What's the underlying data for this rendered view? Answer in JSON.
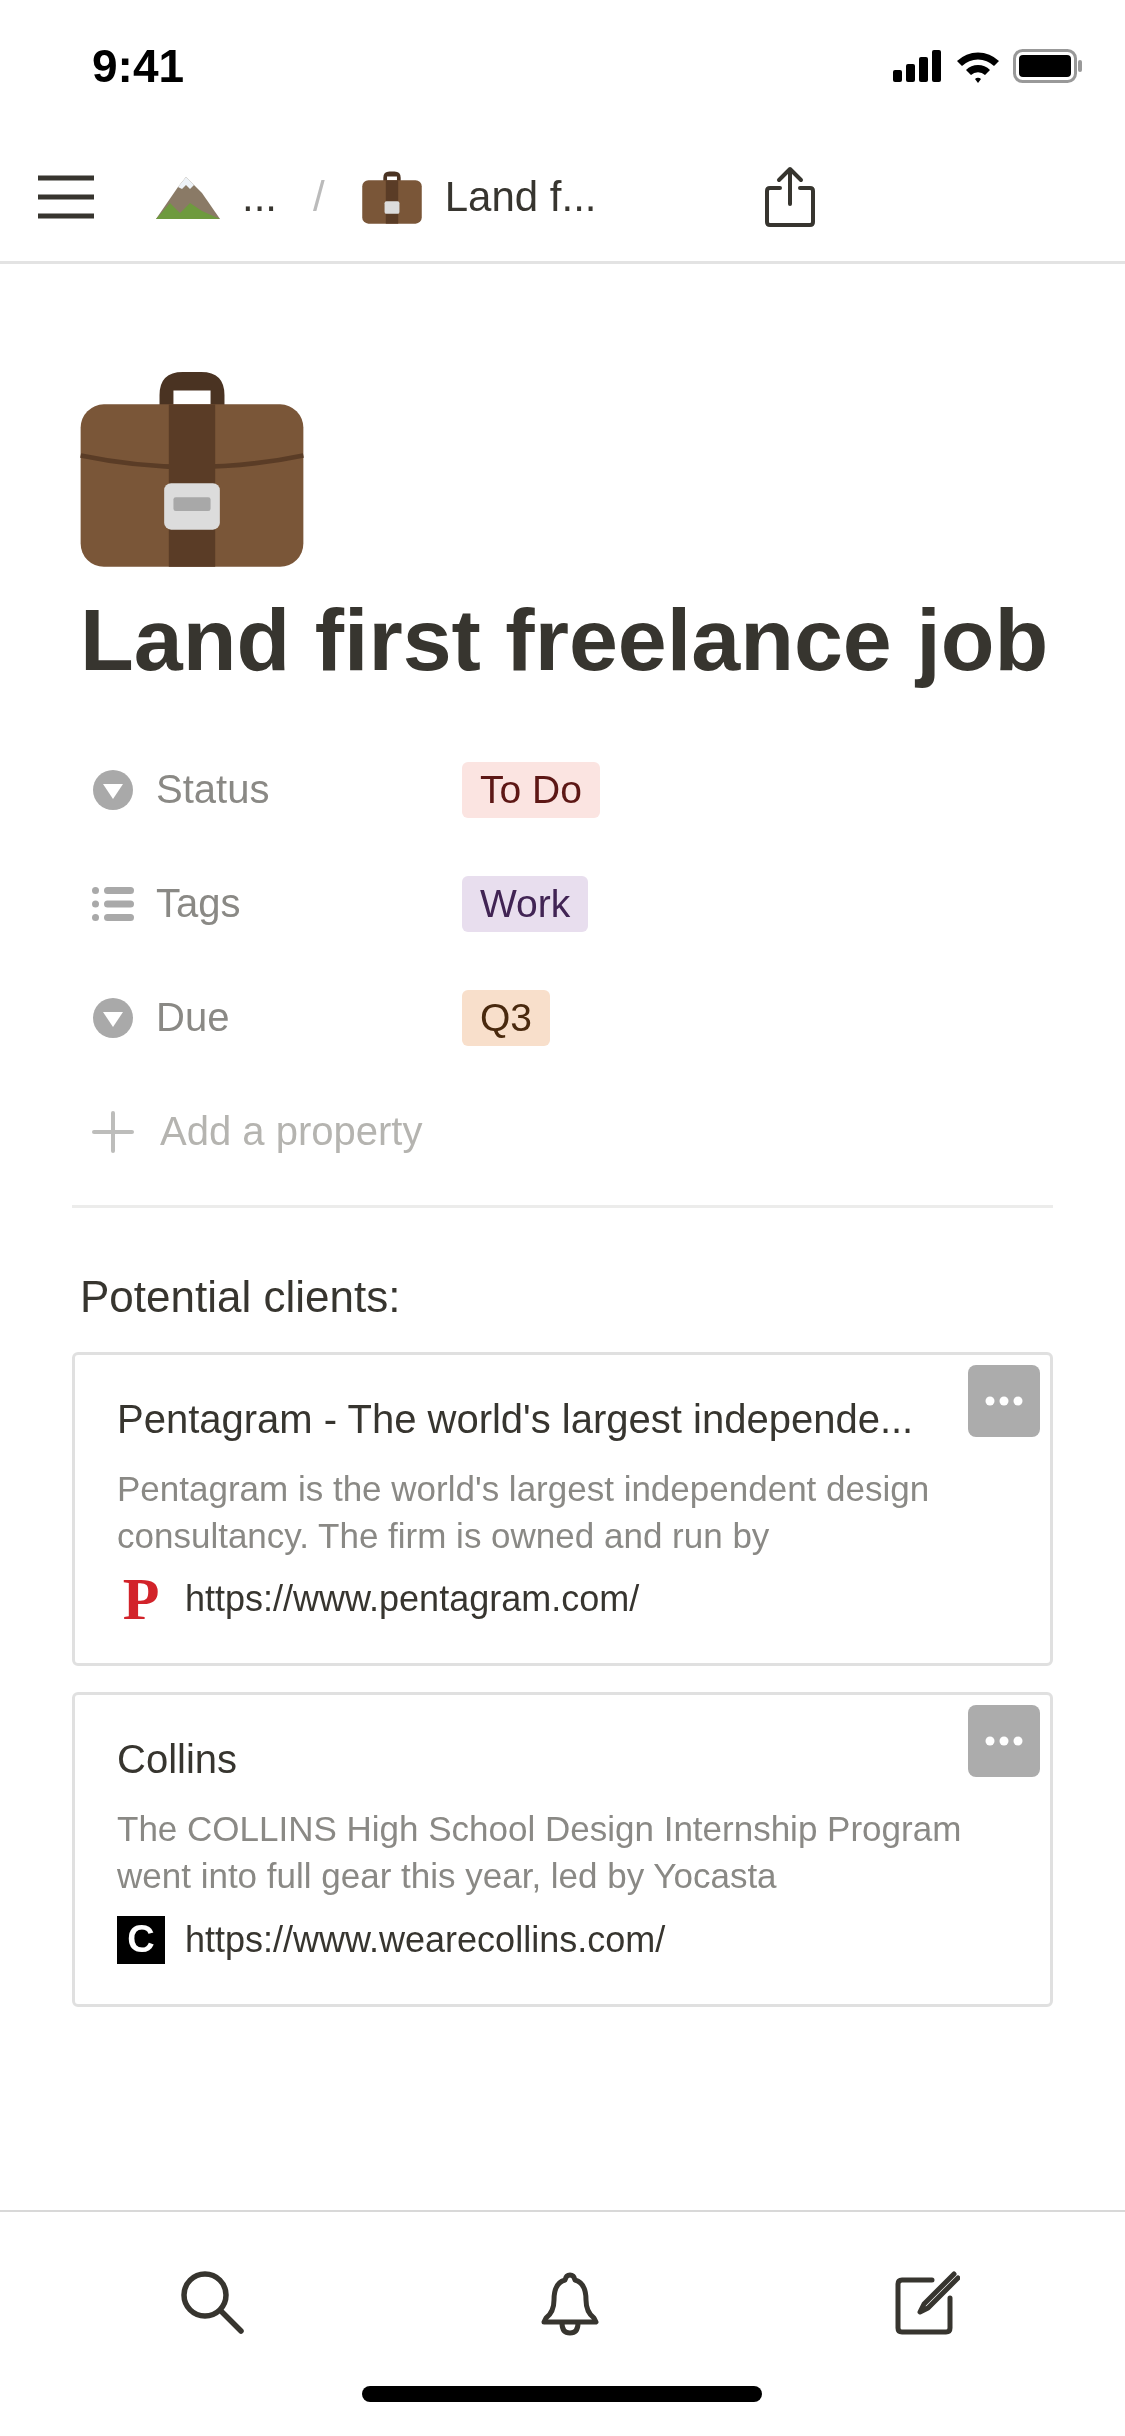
{
  "status_bar": {
    "time": "9:41"
  },
  "nav": {
    "breadcrumb_ellipsis": "...",
    "separator": "/",
    "page": "Land f..."
  },
  "page": {
    "title": "Land first freelance job"
  },
  "properties": [
    {
      "kind": "select",
      "label": "Status",
      "value": "To Do",
      "color": "#fbe4e1"
    },
    {
      "kind": "multi_select",
      "label": "Tags",
      "value": "Work",
      "color": "#e8deee"
    },
    {
      "kind": "select",
      "label": "Due",
      "value": "Q3",
      "color": "#f8dfcb"
    }
  ],
  "add_property": "Add a property",
  "section_heading": "Potential clients:",
  "bookmarks": [
    {
      "kind": "pentagram",
      "title": "Pentagram - The world's largest independe...",
      "description": "Pentagram is the world's largest independent design consultancy. The firm is owned and run by",
      "url": "https://www.pentagram.com/",
      "favicon": "P"
    },
    {
      "kind": "collins",
      "title": "Collins",
      "description": "The COLLINS High School Design Internship Program went into full gear this year, led by Yocasta",
      "url": "https://www.wearecollins.com/",
      "favicon": "C"
    }
  ]
}
